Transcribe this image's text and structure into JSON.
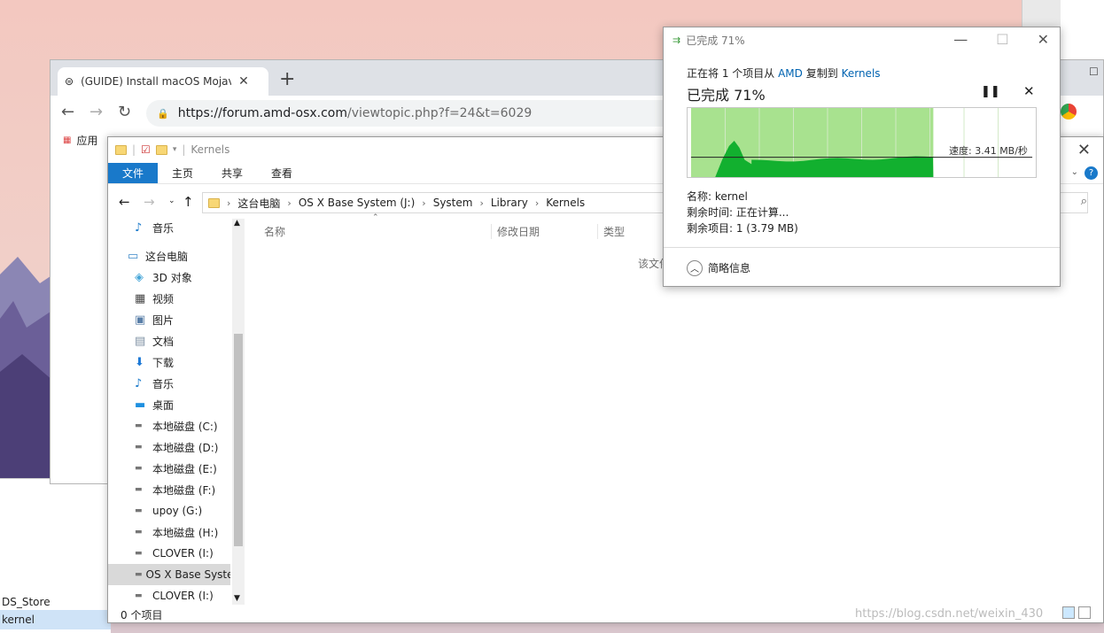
{
  "chrome": {
    "tab_title": "(GUIDE) Install macOS Mojave c",
    "url_host": "https://forum.amd-osx.com",
    "url_path": "/viewtopic.php?f=24&t=6029",
    "bookmark_apps": "应用"
  },
  "background_window": {
    "items": [
      "DS_Store",
      "kernel"
    ]
  },
  "explorer": {
    "title": "Kernels",
    "ribbon": [
      "文件",
      "主页",
      "共享",
      "查看"
    ],
    "breadcrumb": [
      "这台电脑",
      "OS X Base System (J:)",
      "System",
      "Library",
      "Kernels"
    ],
    "nav_items": [
      {
        "label": "音乐",
        "icon": "music-icon"
      },
      {
        "label": "这台电脑",
        "icon": "computer-icon"
      },
      {
        "label": "3D 对象",
        "icon": "cube-icon"
      },
      {
        "label": "视频",
        "icon": "video-icon"
      },
      {
        "label": "图片",
        "icon": "picture-icon"
      },
      {
        "label": "文档",
        "icon": "document-icon"
      },
      {
        "label": "下载",
        "icon": "download-icon"
      },
      {
        "label": "音乐",
        "icon": "music-icon"
      },
      {
        "label": "桌面",
        "icon": "desktop-icon"
      },
      {
        "label": "本地磁盘 (C:)",
        "icon": "drive-icon"
      },
      {
        "label": "本地磁盘 (D:)",
        "icon": "drive-icon"
      },
      {
        "label": "本地磁盘 (E:)",
        "icon": "drive-icon"
      },
      {
        "label": "本地磁盘 (F:)",
        "icon": "drive-icon"
      },
      {
        "label": "upoy (G:)",
        "icon": "drive-icon"
      },
      {
        "label": "本地磁盘 (H:)",
        "icon": "drive-icon"
      },
      {
        "label": "CLOVER (I:)",
        "icon": "drive-icon"
      },
      {
        "label": "OS X Base Syste",
        "icon": "drive-icon"
      },
      {
        "label": "CLOVER (I:)",
        "icon": "drive-icon"
      }
    ],
    "columns": [
      "名称",
      "修改日期",
      "类型"
    ],
    "empty_text": "该文件",
    "status": "0 个项目"
  },
  "copy_dialog": {
    "title": "已完成 71%",
    "line_prefix": "正在将 1 个项目从",
    "source": "AMD",
    "line_mid": "复制到",
    "dest": "Kernels",
    "percent_text": "已完成 71%",
    "progress": 0.71,
    "speed": "速度: 3.41 MB/秒",
    "name_label": "名称: kernel",
    "time_label": "剩余时间: 正在计算...",
    "items_label": "剩余项目: 1 (3.79 MB)",
    "less_details": "简略信息"
  },
  "watermark": "https://blog.csdn.net/weixin_430"
}
